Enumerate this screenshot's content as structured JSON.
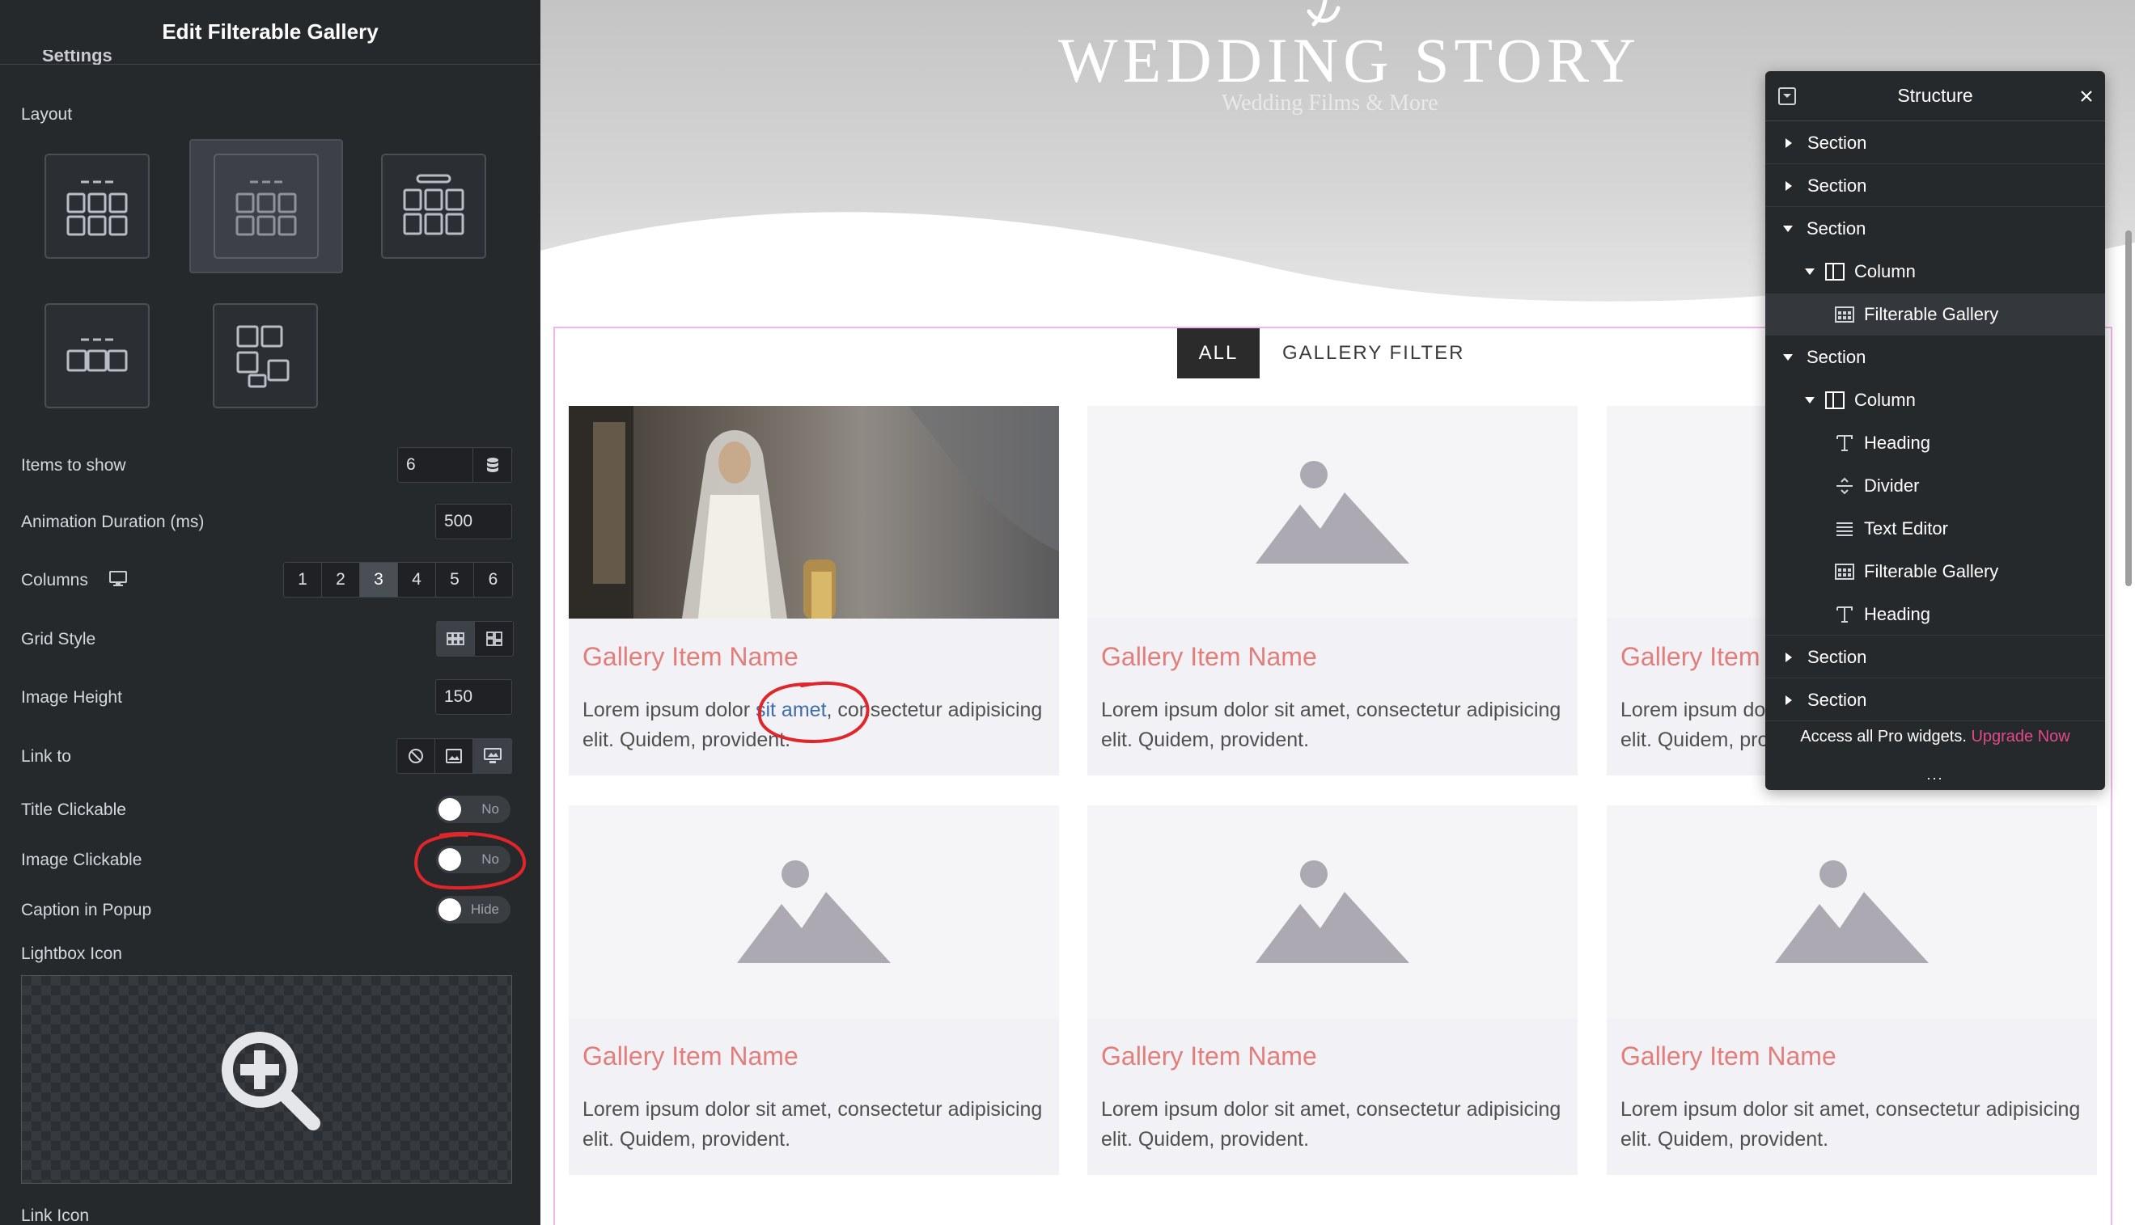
{
  "panel": {
    "title": "Edit Filterable Gallery",
    "cut_label": "Settings",
    "layout_label": "Layout",
    "items_to_show": {
      "label": "Items to show",
      "value": "6"
    },
    "animation_duration": {
      "label": "Animation Duration (ms)",
      "value": "500"
    },
    "columns": {
      "label": "Columns",
      "options": [
        "1",
        "2",
        "3",
        "4",
        "5",
        "6"
      ],
      "selected": "3"
    },
    "grid_style": {
      "label": "Grid Style"
    },
    "image_height": {
      "label": "Image Height",
      "value": "150"
    },
    "link_to": {
      "label": "Link to"
    },
    "title_clickable": {
      "label": "Title Clickable",
      "state": "No"
    },
    "image_clickable": {
      "label": "Image Clickable",
      "state": "No"
    },
    "caption_popup": {
      "label": "Caption in Popup",
      "state": "Hide"
    },
    "lightbox_icon": {
      "label": "Lightbox Icon",
      "icon": "search-plus-icon"
    },
    "link_icon": {
      "label": "Link Icon"
    }
  },
  "canvas": {
    "hero_title": "WEDDING STORY",
    "hero_subtitle": "Wedding Films & More",
    "filters": {
      "all": "ALL",
      "gallery": "GALLERY FILTER"
    },
    "cards": [
      {
        "title": "Gallery Item Name",
        "desc_before": "Lorem ipsum dolor ",
        "desc_link": "sit amet",
        "desc_after": ", consectetur adipisicing elit. Quidem, provident."
      },
      {
        "title": "Gallery Item Name",
        "desc": "Lorem ipsum dolor sit amet, consectetur adipisicing elit. Quidem, provident."
      },
      {
        "title": "Gallery Item Name",
        "desc": "Lorem ipsum dolor sit amet, consectetur adipisicing elit. Quidem, provident."
      },
      {
        "title": "Gallery Item Name",
        "desc": "Lorem ipsum dolor sit amet, consectetur adipisicing elit. Quidem, provident."
      },
      {
        "title": "Gallery Item Name",
        "desc": "Lorem ipsum dolor sit amet, consectetur adipisicing elit. Quidem, provident."
      },
      {
        "title": "Gallery Item Name",
        "desc": "Lorem ipsum dolor sit amet, consectetur adipisicing elit. Quidem, provident."
      }
    ]
  },
  "structure": {
    "title": "Structure",
    "items": [
      {
        "label": "Section"
      },
      {
        "label": "Section"
      },
      {
        "label": "Section"
      },
      {
        "label": "Column"
      },
      {
        "label": "Filterable Gallery"
      },
      {
        "label": "Section"
      },
      {
        "label": "Column"
      },
      {
        "label": "Heading"
      },
      {
        "label": "Divider"
      },
      {
        "label": "Text Editor"
      },
      {
        "label": "Filterable Gallery"
      },
      {
        "label": "Heading"
      },
      {
        "label": "Section"
      },
      {
        "label": "Section"
      }
    ],
    "footer_text": "Access all Pro widgets.",
    "footer_link": "Upgrade Now",
    "more": "..."
  },
  "colors": {
    "panel_bg": "#26292c",
    "accent_pink": "#e2498a",
    "card_title": "#e27d7a",
    "annotation_red": "#e0262a"
  }
}
